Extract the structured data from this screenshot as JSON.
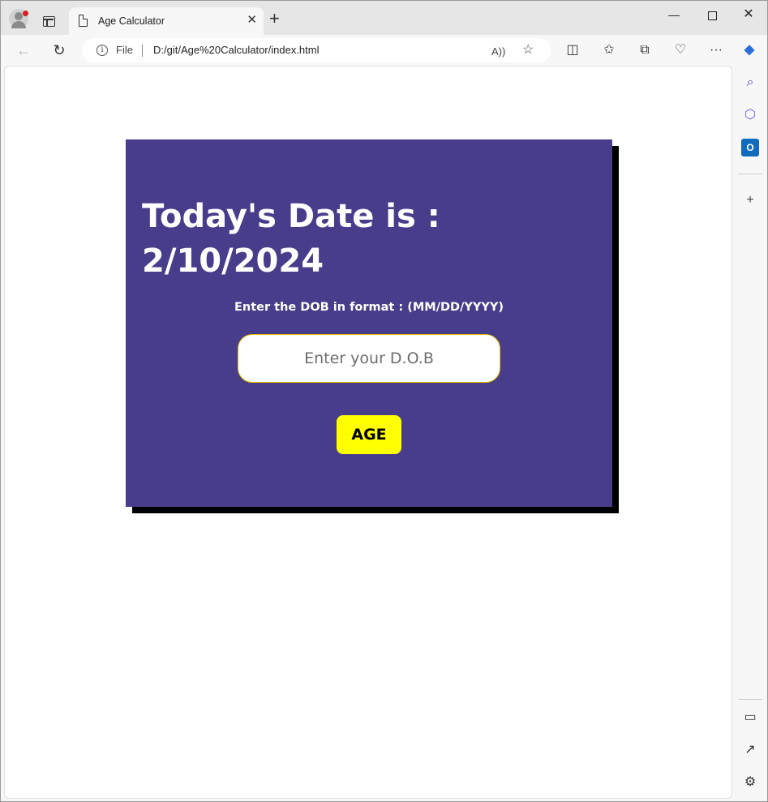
{
  "browser": {
    "tab_title": "Age Calculator",
    "tab_close": "✕",
    "new_tab": "+",
    "minimize": "—",
    "close": "✕",
    "back": "←",
    "reload": "↻",
    "info": "i",
    "scheme_label": "File",
    "url": "D:/git/Age%20Calculator/index.html",
    "read_aloud": "A))",
    "favorite": "☆",
    "split": "◫",
    "favorites": "✩",
    "collections": "⧉",
    "health": "♡",
    "more": "···"
  },
  "sidebar": {
    "search": "⌕",
    "add": "+",
    "layout": "▭",
    "external": "↗",
    "settings": "⚙"
  },
  "page": {
    "heading": "Today's Date is : 2/10/2024",
    "dob_label": "Enter the DOB in format : (MM/DD/YYYY)",
    "dob_placeholder": "Enter your D.O.B",
    "dob_value": "",
    "age_button": "AGE"
  },
  "colors": {
    "card": "#483d8b",
    "shadow": "#000000",
    "button": "#ffff00",
    "input_border": "#e6c200"
  }
}
